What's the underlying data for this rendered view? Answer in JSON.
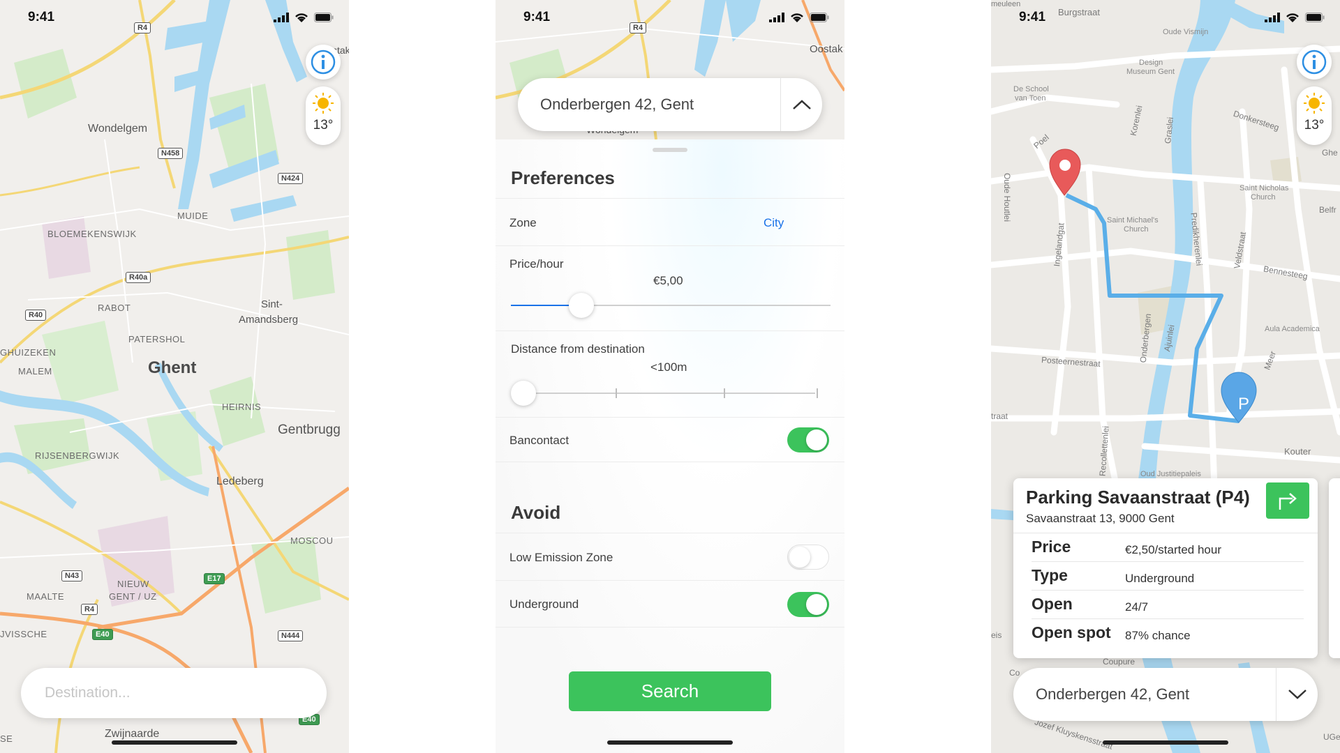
{
  "status": {
    "time": "9:41"
  },
  "screen1": {
    "weather_temp": "13°",
    "destination_placeholder": "Destination...",
    "map_labels": {
      "city": "Ghent",
      "wondelgem": "Wondelgem",
      "muide": "MUIDE",
      "bloemekenswijk": "BLOEMEKENSWIJK",
      "rabot": "RABOT",
      "patershol": "PATERSHOL",
      "sint_amandsberg_1": "Sint-",
      "sint_amandsberg_2": "Amandsberg",
      "ghuizeken": "GHUIZEKEN",
      "malem": "MALEM",
      "heirnis": "HEIRNIS",
      "gentbrugge": "Gentbrugg",
      "rijsenbergwijk": "RIJSENBERGWIJK",
      "ledeberg": "Ledeberg",
      "moscou": "MOSCOU",
      "nieuw_gent_1": "NIEUW",
      "nieuw_gent_2": "GENT / UZ",
      "maalte": "MAALTE",
      "vissche": "JVISSCHE",
      "zwijnaarde": "Zwijnaarde",
      "ostak": "stak",
      "se": "SE"
    },
    "roads": {
      "r4_top": "R4",
      "n458": "N458",
      "n424": "N424",
      "r40a": "R40a",
      "r40": "R40",
      "n43": "N43",
      "r4_bottom": "R4",
      "e17": "E17",
      "e40": "E40",
      "n444": "N444",
      "e40_b": "E40"
    }
  },
  "screen2": {
    "address": "Onderbergen 42, Gent",
    "preferences_title": "Preferences",
    "zone_label": "Zone",
    "zone_value": "City",
    "price_label": "Price/hour",
    "price_value": "€5,00",
    "price_level": 0.22,
    "distance_label": "Distance from destination",
    "distance_value": "<100m",
    "distance_level": 0,
    "bancontact_label": "Bancontact",
    "bancontact_on": true,
    "avoid_title": "Avoid",
    "low_emission_label": "Low Emission Zone",
    "low_emission_on": false,
    "underground_label": "Underground",
    "underground_on": true,
    "search_label": "Search",
    "map_labels": {
      "r4": "R4",
      "ostak": "Oostak",
      "wondelgem": "Wondelgem"
    }
  },
  "screen3": {
    "weather_temp": "13°",
    "parking_name": "Parking Savaanstraat (P4)",
    "parking_address": "Savaanstraat 13, 9000 Gent",
    "rows": [
      {
        "key": "Price",
        "value": "€2,50/started hour"
      },
      {
        "key": "Type",
        "value": "Underground"
      },
      {
        "key": "Open",
        "value": "24/7"
      },
      {
        "key": "Open spot",
        "value": "87% chance"
      }
    ],
    "address": "Onderbergen 42, Gent",
    "parking_marker": "P",
    "map_labels": {
      "burgstraat": "Burgstraat",
      "meuleen": "meuleen",
      "oude_vismijn": "Oude Vismijn",
      "design_museum_1": "Design",
      "design_museum_2": "Museum Gent",
      "de_school_1": "De School",
      "de_school_2": "van Toen",
      "donkersteeg": "Donkersteeg",
      "poel": "Poel",
      "korenlei": "Korenlei",
      "graslei": "Graslei",
      "saint_nicholas_1": "Saint Nicholas",
      "saint_nicholas_2": "Church",
      "belfr": "Belfr",
      "saint_michaels_1": "Saint Michael's",
      "saint_michaels_2": "Church",
      "predikherenlei": "Predikherenlei",
      "ingelandgat": "Ingelandgat",
      "veldstraat": "Veldstraat",
      "bennesteeg": "Bennesteeg",
      "aula_academica": "Aula Academica",
      "onderbergen": "Onderbergen",
      "posteernestraat": "Posteernestraat",
      "ajuinlei": "Ajuinlei",
      "meer": "Meer",
      "kouter": "Kouter",
      "sttraat": "traat",
      "ghe": "Ghe",
      "oude_houtlei": "Oude Houtlei",
      "recollettenlei": "Recollettenlei",
      "justitiepaleis": "Oud Justitiepaleis",
      "coupure": "Coupure",
      "jozef_kluyskensstraat": "Jozef Kluyskensstraat",
      "uge": "UGe",
      "ees": "eis",
      "co": "Co"
    }
  },
  "colors": {
    "green": "#3cc35c",
    "blue_link": "#1a72e8",
    "route": "#5aaee8",
    "pin_red": "#e85a5a",
    "pin_blue": "#5aa6e6",
    "water": "#a9d8f2",
    "park": "#cfe9c4"
  },
  "icons": {
    "info": "info-icon",
    "weather": "sun-icon",
    "chevron_up": "chevron-up-icon",
    "chevron_down": "chevron-down-icon",
    "navigate": "navigate-arrow-icon",
    "signal": "signal-icon",
    "wifi": "wifi-icon",
    "battery": "battery-icon"
  }
}
